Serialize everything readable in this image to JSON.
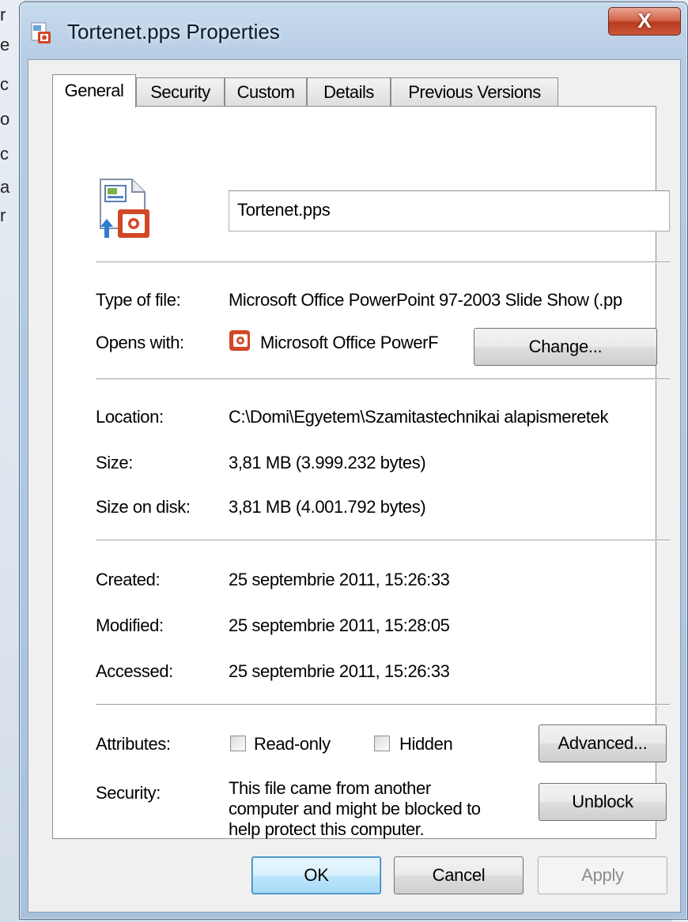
{
  "background": {
    "left_letters": [
      "r",
      "e",
      "c",
      "o",
      "c",
      "a",
      "r"
    ]
  },
  "window": {
    "title": "Tortenet.pps Properties",
    "close_label": "X"
  },
  "tabs": [
    "General",
    "Security",
    "Custom",
    "Details",
    "Previous Versions"
  ],
  "general": {
    "file_name": "Tortenet.pps",
    "type_label": "Type of file:",
    "type_value": "Microsoft Office PowerPoint 97-2003 Slide Show (.pp",
    "opens_label": "Opens with:",
    "opens_value": "Microsoft Office PowerF",
    "change_button": "Change...",
    "location_label": "Location:",
    "location_value": "C:\\Domi\\Egyetem\\Szamitastechnikai alapismeretek",
    "size_label": "Size:",
    "size_value": "3,81 MB (3.999.232 bytes)",
    "size_disk_label": "Size on disk:",
    "size_disk_value": "3,81 MB (4.001.792 bytes)",
    "created_label": "Created:",
    "created_value": "25 septembrie 2011, 15:26:33",
    "modified_label": "Modified:",
    "modified_value": "25 septembrie 2011, 15:28:05",
    "accessed_label": "Accessed:",
    "accessed_value": "25 septembrie 2011, 15:26:33",
    "attributes_label": "Attributes:",
    "readonly_label": "Read-only",
    "readonly_checked": false,
    "hidden_label": "Hidden",
    "hidden_checked": false,
    "advanced_button": "Advanced...",
    "security_label": "Security:",
    "security_text_1": "This file came from another",
    "security_text_2": "computer and might be blocked to",
    "security_text_3": "help protect this computer.",
    "unblock_button": "Unblock"
  },
  "footer": {
    "ok": "OK",
    "cancel": "Cancel",
    "apply": "Apply"
  },
  "colors": {
    "accent": "#3c7fb1",
    "powerpoint": "#d24726"
  }
}
